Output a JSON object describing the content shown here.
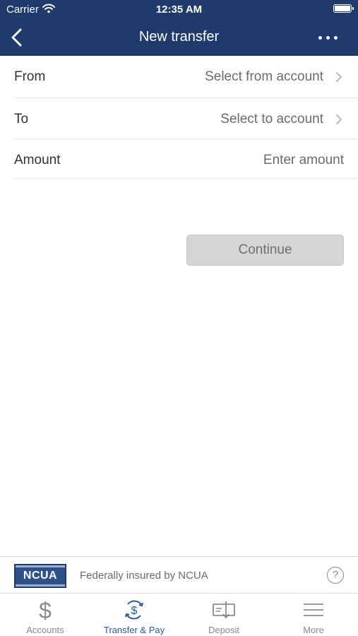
{
  "status_bar": {
    "carrier": "Carrier",
    "time": "12:35 AM"
  },
  "nav": {
    "title": "New transfer"
  },
  "form": {
    "from": {
      "label": "From",
      "value": "Select from account"
    },
    "to": {
      "label": "To",
      "value": "Select to account"
    },
    "amount": {
      "label": "Amount",
      "placeholder": "Enter amount"
    }
  },
  "continue_label": "Continue",
  "footer": {
    "logo_text": "NCUA",
    "caption": "Federally insured by NCUA",
    "help_symbol": "?"
  },
  "tabs": [
    {
      "label": "Accounts",
      "icon": "dollar-icon",
      "active": false
    },
    {
      "label": "Transfer & Pay",
      "icon": "transfer-dollar-icon",
      "active": true
    },
    {
      "label": "Deposit",
      "icon": "check-deposit-icon",
      "active": false
    },
    {
      "label": "More",
      "icon": "hamburger-menu-icon",
      "active": false
    }
  ],
  "colors": {
    "header": "#1f3a6b",
    "active_tab": "#2e5a96",
    "inactive_tab": "#8a8a8a",
    "button_disabled": "#d6d6d6"
  }
}
